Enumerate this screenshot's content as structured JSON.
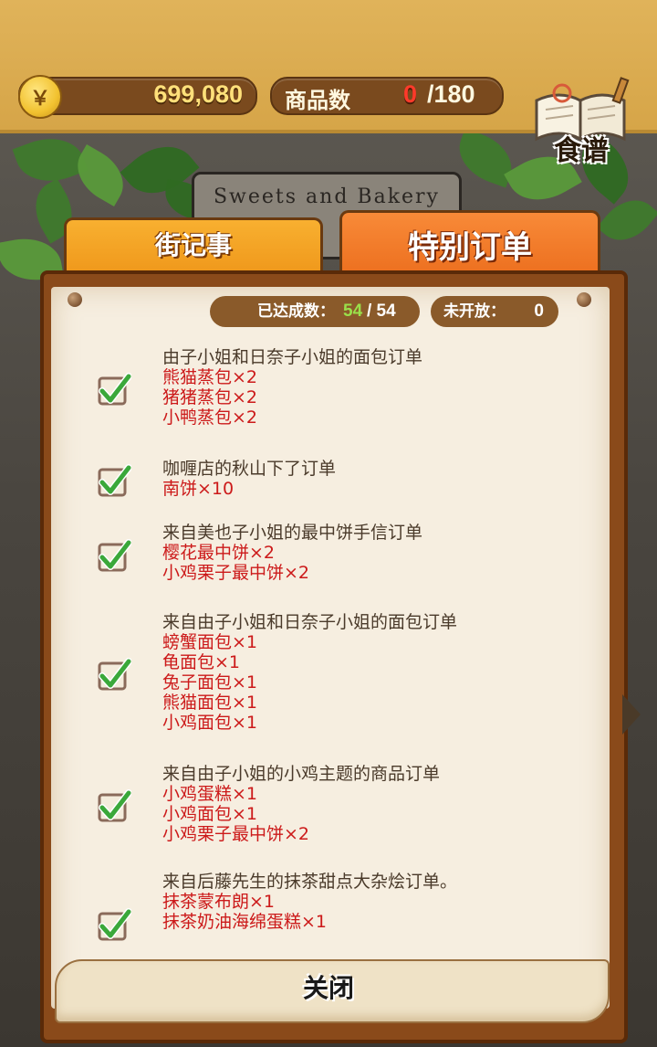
{
  "header": {
    "coin_icon": "￥",
    "coins": "699,080",
    "goods_label": "商品数",
    "goods_current": "0",
    "goods_total": "/180",
    "recipe_label": "食谱"
  },
  "sign": {
    "text": "Sweets and Bakery"
  },
  "tabs": [
    {
      "label": "街记事",
      "active": false
    },
    {
      "label": "特别订单",
      "active": true
    }
  ],
  "stats": {
    "done_label": "已达成数：",
    "done_value": "54",
    "done_total": "/ 54",
    "closed_label": "未开放：",
    "closed_value": "0"
  },
  "orders": [
    {
      "title": "由子小姐和日奈子小姐的面包订单",
      "items": [
        "熊猫蒸包×2",
        "猪猪蒸包×2",
        "小鸭蒸包×2"
      ],
      "completed": true
    },
    {
      "title": "咖喱店的秋山下了订单",
      "items": [
        "南饼×10"
      ],
      "completed": true
    },
    {
      "title": "来自美也子小姐的最中饼手信订单",
      "items": [
        "樱花最中饼×2",
        "小鸡栗子最中饼×2"
      ],
      "completed": true
    },
    {
      "title": "来自由子小姐和日奈子小姐的面包订单",
      "items": [
        "螃蟹面包×1",
        "龟面包×1",
        "兔子面包×1",
        "熊猫面包×1",
        "小鸡面包×1"
      ],
      "completed": true
    },
    {
      "title": "来自由子小姐的小鸡主题的商品订单",
      "items": [
        "小鸡蛋糕×1",
        "小鸡面包×1",
        "小鸡栗子最中饼×2"
      ],
      "completed": true
    },
    {
      "title": "来自后藤先生的抹茶甜点大杂烩订单。",
      "items": [
        "抹茶蒙布朗×1",
        "抹茶奶油海绵蛋糕×1"
      ],
      "completed": true
    }
  ],
  "footer": {
    "close_label": "关闭"
  },
  "colors": {
    "accent": "#ea6a1a",
    "item_text": "#cc1a1a",
    "done_num": "#9ae04a"
  }
}
